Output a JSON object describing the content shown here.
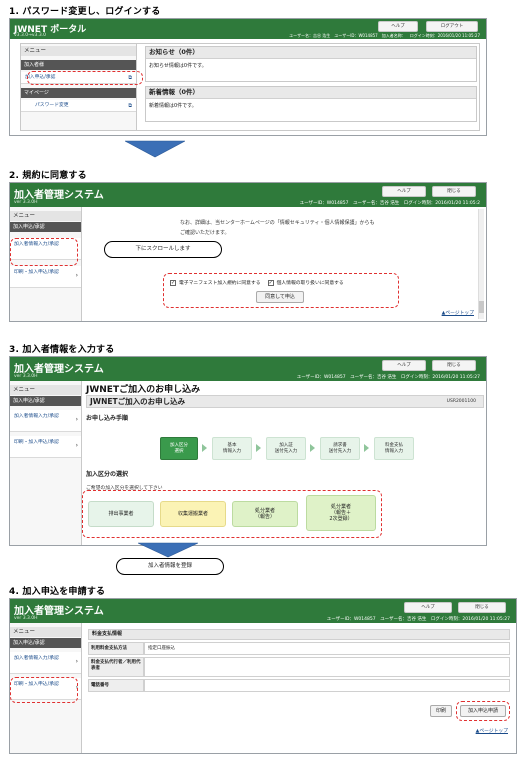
{
  "step1": {
    "title": "1. パスワード変更し、ログインする",
    "app_title": "JWNET ポータル",
    "version": "v3.3.0→v3.3.0",
    "help_label": "ヘルプ",
    "logout_label": "ログアウト",
    "user_info": "ユーザー名：吉谷 浩生　ユーザーID：W014857　加入者名称：　ログイン時刻：2016/01/20 11:05:27",
    "menu_title": "メニュー",
    "section_member": "加入者様",
    "item_apply": "加入申込/承認",
    "section_mypage": "マイページ",
    "item_password": "パスワード変更",
    "notice_title": "お知らせ（0件）",
    "notice_text": "お知らせ情報は0件です。",
    "news_title": "新着情報（0件）",
    "news_text": "新着情報は0件です。"
  },
  "step2": {
    "title": "2. 規約に同意する",
    "app_title": "加入者管理システム",
    "version": "ver  3.3.0H",
    "help_label": "ヘルプ",
    "close_label": "閉じる",
    "user_info": "ユーザーID：W014857　ユーザー名：吉谷 浩生　ログイン時刻：2016/01/20 11:05:2",
    "menu_title": "メニュー",
    "section_apply": "加入申込/承認",
    "item_info_input": "加入者情報入力/承認",
    "item_print": "印刷・加入申込/承認",
    "body_text": "なお、詳細は、当センターホームページの「情報セキュリティ・個人情報保護」からも",
    "body_text2": "ご確認いただけます。",
    "scroll_callout": "下にスクロールします",
    "checkbox1": "電子マニフェスト加入規約に同意する",
    "checkbox2": "個人情報の取り扱いに同意する",
    "agree_button": "同意して申込",
    "page_top": "▲ページトップ"
  },
  "step3": {
    "title": "3. 加入者情報を入力する",
    "app_title": "加入者管理システム",
    "version": "ver  3.3.0H",
    "help_label": "ヘルプ",
    "close_label": "閉じる",
    "user_info": "ユーザーID：W014857　ユーザー名：吉谷 浩生　ログイン時刻：2016/01/20 11:05:27",
    "menu_title": "メニュー",
    "section_apply": "加入申込/承認",
    "item_info_input": "加入者情報入力/承認",
    "item_print": "印刷・加入申込/承認",
    "heading": "JWNETご加入のお申し込み",
    "panel_title": "JWNETご加入のお申し込み",
    "screen_id": "USR2001100",
    "procedure_label": "お申し込み手順",
    "steps": [
      {
        "line1": "加入区分",
        "line2": "選択"
      },
      {
        "line1": "基本",
        "line2": "情報入力"
      },
      {
        "line1": "加入証",
        "line2": "送付先入力"
      },
      {
        "line1": "請求書",
        "line2": "送付先入力"
      },
      {
        "line1": "料金支払",
        "line2": "情報入力"
      }
    ],
    "category_label": "加入区分の選択",
    "category_instruction": "ご希望の加入区分を選択して下さい",
    "categories": [
      {
        "line1": "排出事業者",
        "line2": "",
        "line3": ""
      },
      {
        "line1": "収集運搬業者",
        "line2": "",
        "line3": ""
      },
      {
        "line1": "処分業者",
        "line2": "（報告）",
        "line3": ""
      },
      {
        "line1": "処分業者",
        "line2": "（報告＋",
        "line3": "2次登録）"
      }
    ],
    "register_callout": "加入者情報を登録"
  },
  "step4": {
    "title": "4. 加入申込を申請する",
    "app_title": "加入者管理システム",
    "version": "ver  3.3.0H",
    "help_label": "ヘルプ",
    "close_label": "閉じる",
    "user_info": "ユーザーID：W014857　ユーザー名：吉谷 浩生　ログイン時刻：2016/01/20 11:05:27",
    "menu_title": "メニュー",
    "section_apply": "加入申込/承認",
    "item_info_input": "加入者情報入力/承認",
    "item_print": "印刷・加入申込/承認",
    "payment_section": "料金支払情報",
    "row1_label": "利用料金支払方法",
    "row1_value": "指定口座振込",
    "row2_label": "料金支払代行者／利用代表者",
    "row3_label": "電話番号",
    "print_button": "印刷",
    "submit_button": "加入申込申請",
    "page_top": "▲ページトップ"
  },
  "colors": {
    "header_green": "#2f7a3b",
    "dashed_red": "#e03030",
    "link_blue": "#1a4b8a",
    "arrow_blue": "#3b6fb6"
  }
}
